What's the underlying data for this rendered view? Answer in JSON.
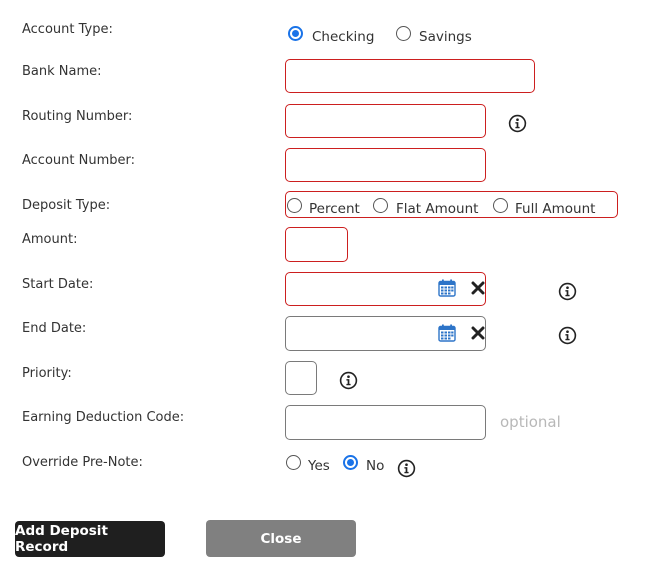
{
  "form": {
    "account_type": {
      "label": "Account Type:",
      "options": [
        {
          "label": "Checking",
          "checked": true
        },
        {
          "label": "Savings",
          "checked": false
        }
      ]
    },
    "bank_name": {
      "label": "Bank Name:",
      "value": ""
    },
    "routing_number": {
      "label": "Routing Number:",
      "value": ""
    },
    "account_number": {
      "label": "Account Number:",
      "value": ""
    },
    "deposit_type": {
      "label": "Deposit Type:",
      "options": [
        {
          "label": "Percent",
          "checked": false
        },
        {
          "label": "Flat Amount",
          "checked": false
        },
        {
          "label": "Full Amount",
          "checked": false
        }
      ]
    },
    "amount": {
      "label": "Amount:",
      "value": ""
    },
    "start_date": {
      "label": "Start Date:",
      "value": ""
    },
    "end_date": {
      "label": "End Date:",
      "value": ""
    },
    "priority": {
      "label": "Priority:",
      "value": ""
    },
    "earning_deduction_code": {
      "label": "Earning Deduction Code:",
      "value": "",
      "hint": "optional"
    },
    "override_pre_note": {
      "label": "Override Pre-Note:",
      "options": [
        {
          "label": "Yes",
          "checked": false
        },
        {
          "label": "No",
          "checked": true
        }
      ]
    }
  },
  "buttons": {
    "add": "Add Deposit Record",
    "close": "Close"
  },
  "colors": {
    "required_border": "#cc1f1f",
    "radio_accent": "#1a73e8",
    "primary_button": "#1f1f1f",
    "secondary_button": "#808080"
  },
  "icons": [
    "info-icon",
    "calendar-icon",
    "clear-icon"
  ]
}
